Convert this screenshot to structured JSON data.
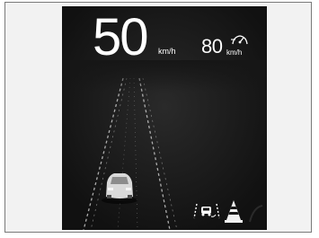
{
  "meter": {
    "current_speed": "50",
    "current_speed_unit": "km/h",
    "set_speed": "80",
    "set_speed_unit": "km/h",
    "icons": {
      "cruise": "cruise-control-icon",
      "lane_keep": "lane-keeping-assist-icon",
      "cone": "traffic-cone-icon",
      "edge": "road-departure-icon"
    },
    "colors": {
      "screen_bg": "#161616",
      "text": "#ffffff",
      "lane_line": "#bfbfbf",
      "vehicle": "#e6e6e6"
    }
  }
}
